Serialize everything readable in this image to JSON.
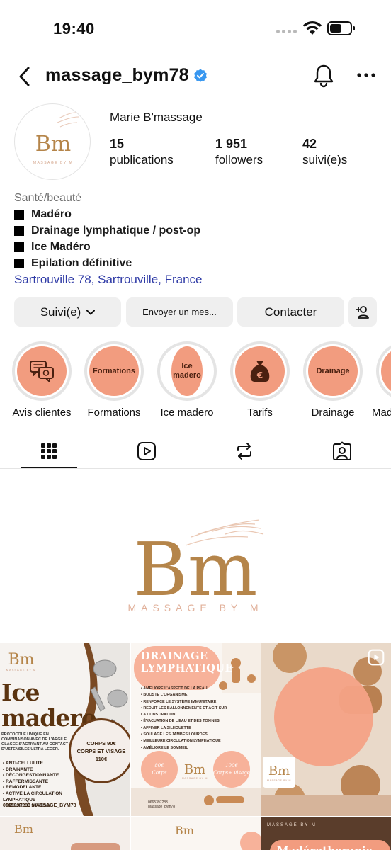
{
  "status_bar": {
    "time": "19:40"
  },
  "header": {
    "username": "massage_bym78",
    "verified": true
  },
  "profile": {
    "display_name": "Marie B'massage",
    "stats": [
      {
        "value": "15",
        "label": "publications"
      },
      {
        "value": "1 951",
        "label": "followers"
      },
      {
        "value": "42",
        "label": "suivi(e)s"
      }
    ],
    "category": "Santé/beauté",
    "bio_lines": [
      "Madéro",
      "Drainage lymphatique / post-op",
      "Ice Madéro",
      "Epilation définitive"
    ],
    "location": "Sartrouville 78, Sartrouville, France",
    "avatar": {
      "initials": "Bm",
      "caption": "MASSAGE BY M"
    }
  },
  "actions": {
    "following_label": "Suivi(e)",
    "message_label": "Envoyer un mes...",
    "contact_label": "Contacter"
  },
  "highlights": [
    {
      "label": "Avis clientes",
      "cover_text": "",
      "icon": "chat-review-icon"
    },
    {
      "label": "Formations",
      "cover_text": "Formations",
      "icon": ""
    },
    {
      "label": "Ice madero",
      "cover_text": "Ice madero",
      "icon": ""
    },
    {
      "label": "Tarifs",
      "cover_text": "",
      "icon": "money-bag-icon"
    },
    {
      "label": "Drainage",
      "cover_text": "Drainage",
      "icon": ""
    },
    {
      "label": "Mad",
      "cover_text": "",
      "icon": ""
    }
  ],
  "tabs": [
    {
      "name": "posts",
      "icon": "grid-icon",
      "active": true
    },
    {
      "name": "reels",
      "icon": "reels-icon",
      "active": false
    },
    {
      "name": "reposts",
      "icon": "repost-icon",
      "active": false
    },
    {
      "name": "tagged",
      "icon": "tagged-icon",
      "active": false
    }
  ],
  "banner": {
    "logo_text": "Bm",
    "tagline": "MASSAGE BY M"
  },
  "posts": {
    "p1": {
      "logo": "Bm",
      "logo_caption": "MASSAGE BY M",
      "title_line1": "Ice",
      "title_line2": "madero",
      "description": "PROTOCOLE UNIQUE EN COMBINAISON AVEC DE L'ARGILE GLACÉE S'ACTIVANT AU CONTACT D'USTENSILES ULTRA LÉGER.",
      "benefits": [
        "• ANTI-CELLULITE",
        "• DRAINANTE",
        "• DÉCONGESTIONNANTE",
        "• RAFFERMISSANTE",
        "• REMODELANTE",
        "• ACTIVE LA CIRCULATION LYMPHATIQUE",
        "• RÉDUIT LE STRESS"
      ],
      "price_line1": "CORPS 90€",
      "price_line2": "CORPS ET VISAGE",
      "price_line3": "110€",
      "footer": "0665397283   MASSAGE_BYM78"
    },
    "p2": {
      "title_line1": "DRAINAGE",
      "title_line2": "LYMPHATIQUE",
      "benefits": [
        "• AMÉLIORE L'ASPECT DE LA PEAU",
        "• BOOSTE L'ORGANISME",
        "• RENFORCE LE SYSTÈME IMMUNITAIRE",
        "• RÉDUIT LES BALLONNEMENTS ET AGIT SUR",
        "   LA CONSTIPATION",
        "• ÉVACUATION DE L'EAU ET DES TOXINES",
        "• AFFINER LA SILHOUETTE",
        "• SOULAGE LES JAMBES LOURDES",
        "• MEILLEURE CIRCULATION  LYMPHATIQUE",
        "• AMÉLIORE LE SOMMEIL"
      ],
      "price_a_line1": "80€",
      "price_a_line2": "Corps",
      "price_b_line1": "100€",
      "price_b_line2": "Corps+ visage",
      "phone": "0665397283",
      "handle": "Massage_bym78",
      "logo": "Bm",
      "logo_caption": "MASSAGE BY M"
    },
    "p3": {
      "logo": "Bm",
      "logo_caption": "MASSAGE BY M",
      "is_reel": true
    },
    "p6": {
      "title": "Madérotherapie",
      "tag": "MASSAGE BY M"
    }
  },
  "colors": {
    "accent_peach": "#f29c7f",
    "link_blue": "#2f3ba6",
    "verified_blue": "#3897f0",
    "button_grey": "#efefef",
    "gold": "#b5854a"
  }
}
